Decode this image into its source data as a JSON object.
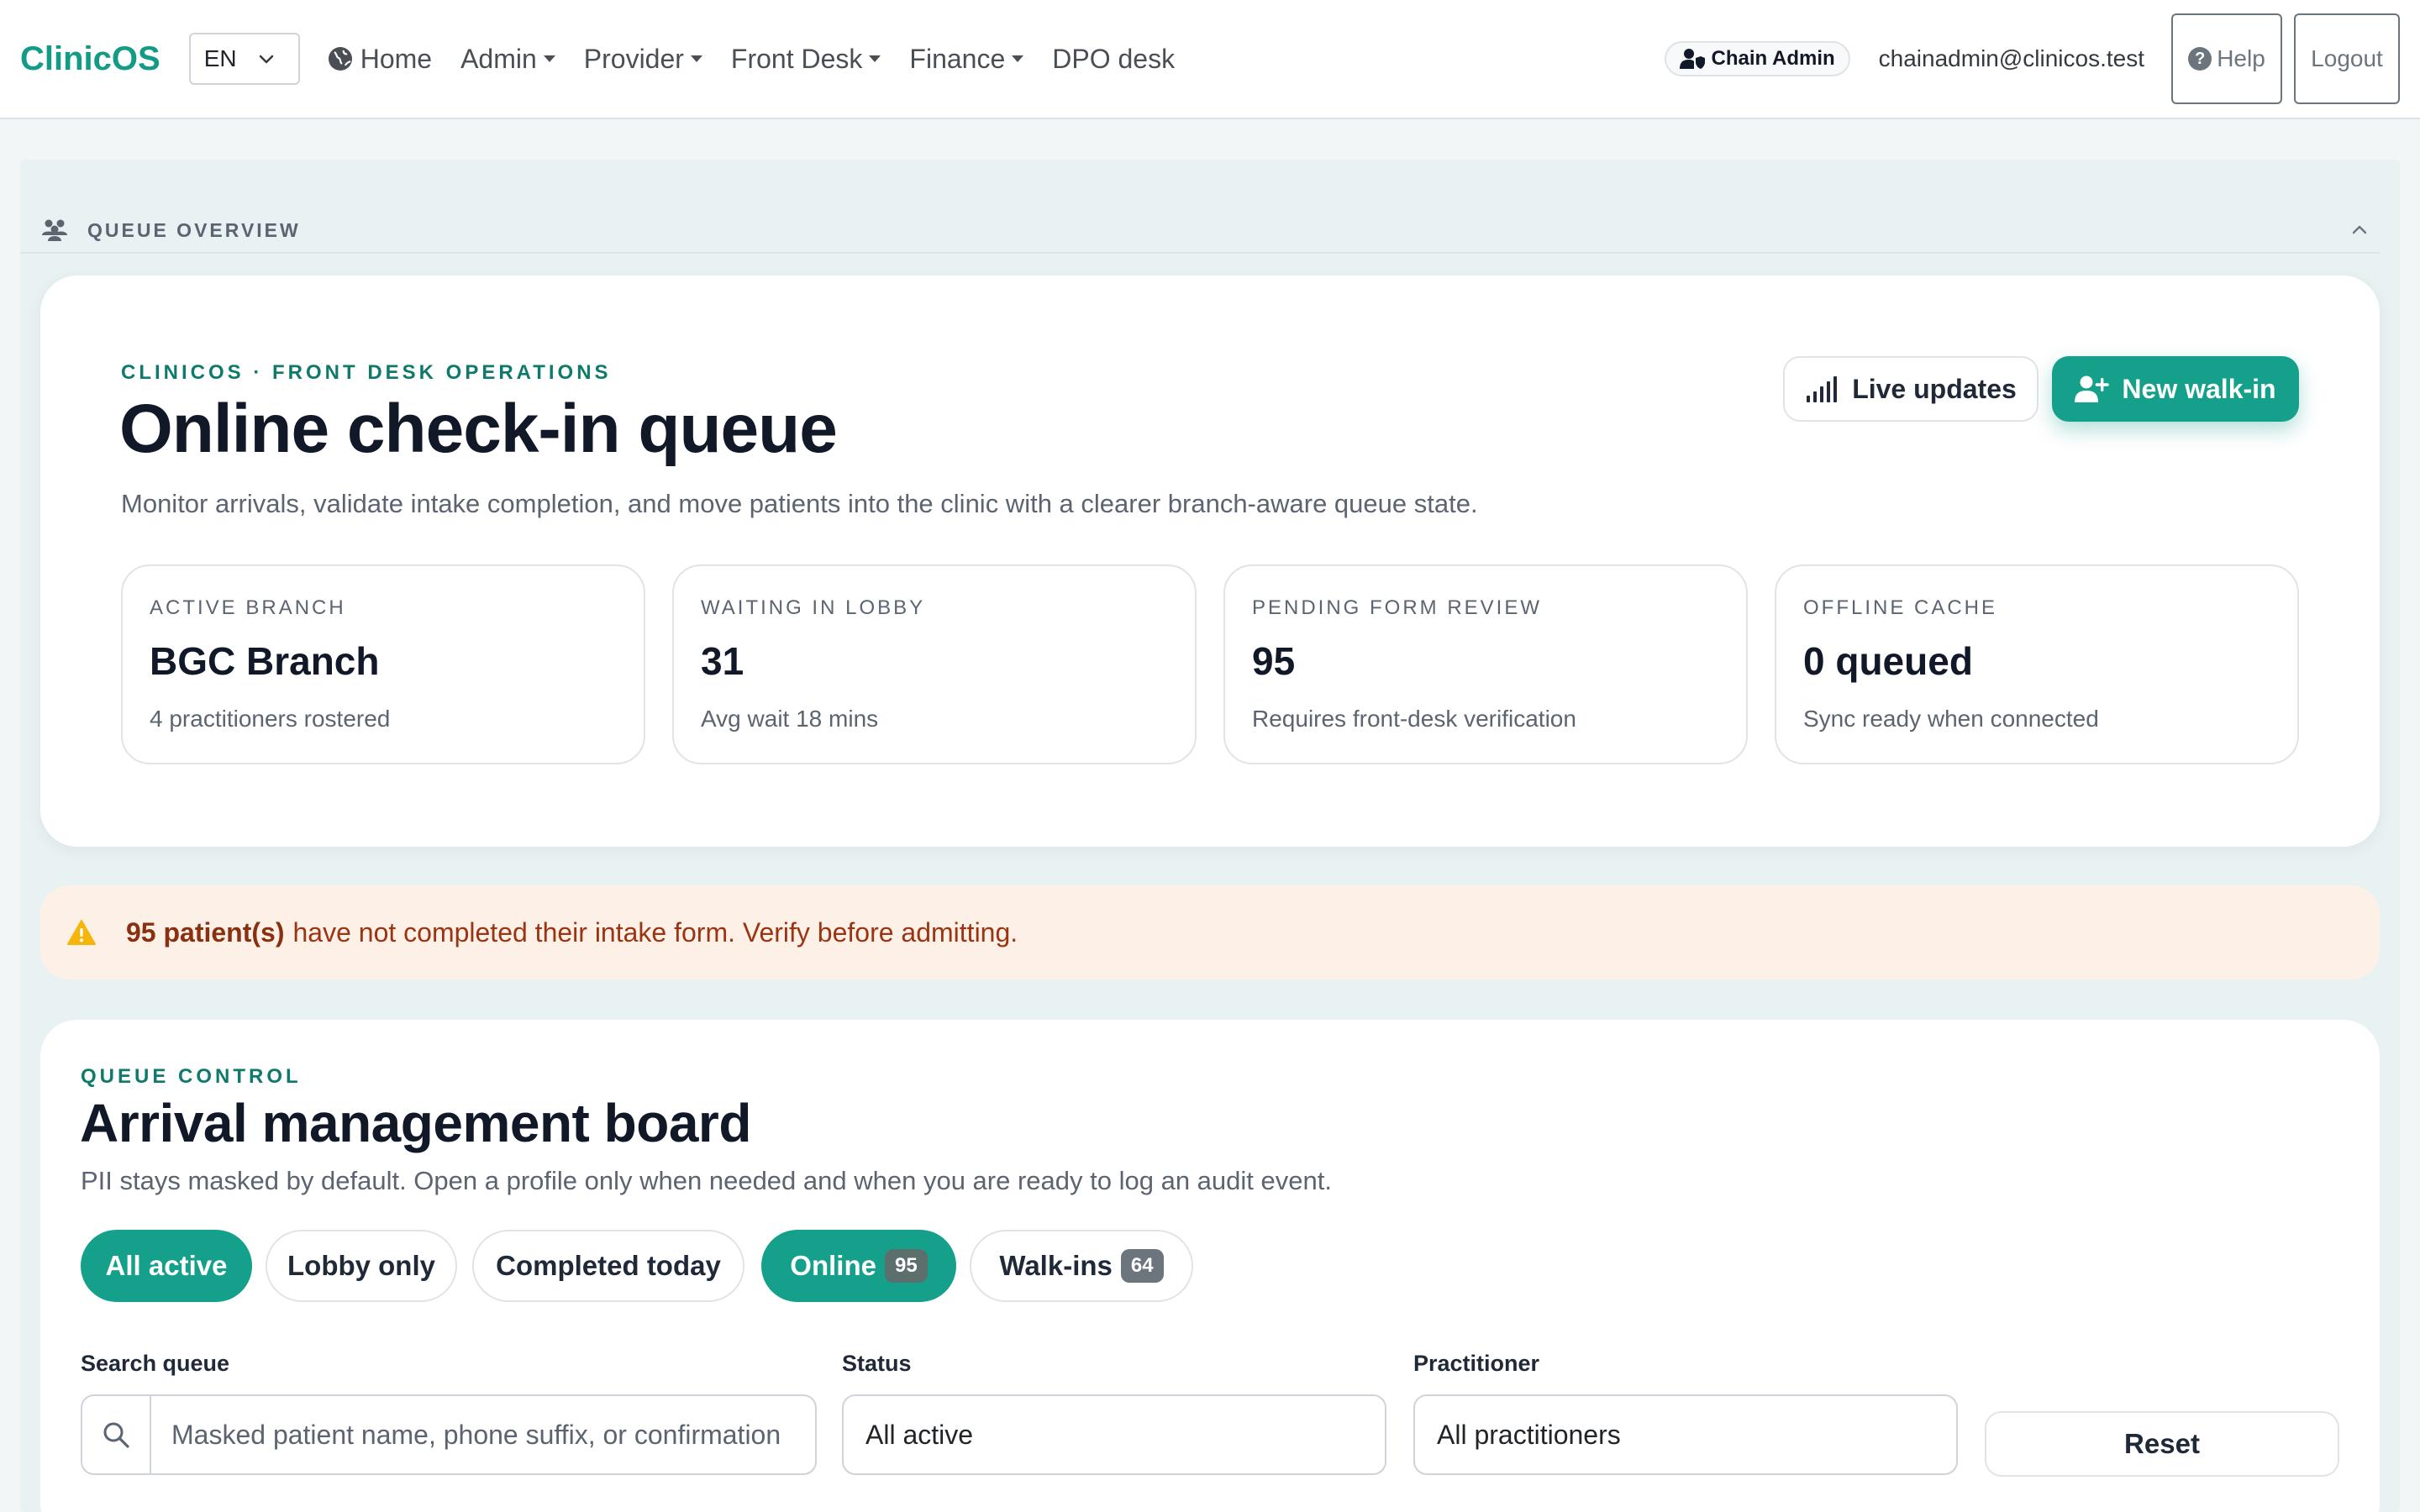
{
  "navbar": {
    "brand": "ClinicOS",
    "language": "EN",
    "items": [
      {
        "label": "Home"
      },
      {
        "label": "Admin"
      },
      {
        "label": "Provider"
      },
      {
        "label": "Front Desk"
      },
      {
        "label": "Finance"
      },
      {
        "label": "DPO desk"
      }
    ],
    "role_badge": "Chain Admin",
    "user_email": "chainadmin@clinicos.test",
    "help_label": "Help",
    "logout_label": "Logout"
  },
  "section": {
    "title": "QUEUE OVERVIEW"
  },
  "hero": {
    "eyebrow": "CLINICOS · FRONT DESK OPERATIONS",
    "title": "Online check-in queue",
    "subtitle": "Monitor arrivals, validate intake completion, and move patients into the clinic with a clearer branch-aware queue state.",
    "live_updates_label": "Live updates",
    "new_walkin_label": "New walk-in",
    "stats": [
      {
        "label": "ACTIVE BRANCH",
        "value": "BGC Branch",
        "note": "4 practitioners rostered"
      },
      {
        "label": "WAITING IN LOBBY",
        "value": "31",
        "note": "Avg wait 18 mins"
      },
      {
        "label": "PENDING FORM REVIEW",
        "value": "95",
        "note": "Requires front-desk verification"
      },
      {
        "label": "OFFLINE CACHE",
        "value": "0 queued",
        "note": "Sync ready when connected"
      }
    ]
  },
  "alert": {
    "strong": "95 patient(s)",
    "text": "have not completed their intake form. Verify before admitting."
  },
  "board": {
    "eyebrow": "QUEUE CONTROL",
    "title": "Arrival management board",
    "subtitle": "PII stays masked by default. Open a profile only when needed and when you are ready to log an audit event.",
    "filters": [
      {
        "label": "All active",
        "active": true
      },
      {
        "label": "Lobby only",
        "active": false
      },
      {
        "label": "Completed today",
        "active": false
      },
      {
        "label": "Online",
        "count": "95",
        "active": true
      },
      {
        "label": "Walk-ins",
        "count": "64",
        "active": false
      }
    ],
    "search": {
      "label": "Search queue",
      "placeholder": "Masked patient name, phone suffix, or confirmation"
    },
    "status": {
      "label": "Status",
      "value": "All active"
    },
    "practitioner": {
      "label": "Practitioner",
      "value": "All practitioners"
    },
    "reset_label": "Reset"
  },
  "colors": {
    "brand": "#139b85",
    "accent": "#14a08a",
    "alert_bg": "#fdf1e7",
    "alert_text": "#9a3412",
    "page_bg": "#e9f2f2"
  },
  "icons": {
    "home": "globe-icon",
    "role": "user-shield-icon",
    "help": "question-circle-icon",
    "section": "people-icon",
    "collapse": "chevron-up-icon",
    "live": "signal-bars-icon",
    "walkin": "user-plus-icon",
    "alert": "warning-triangle-icon",
    "search": "search-icon"
  }
}
